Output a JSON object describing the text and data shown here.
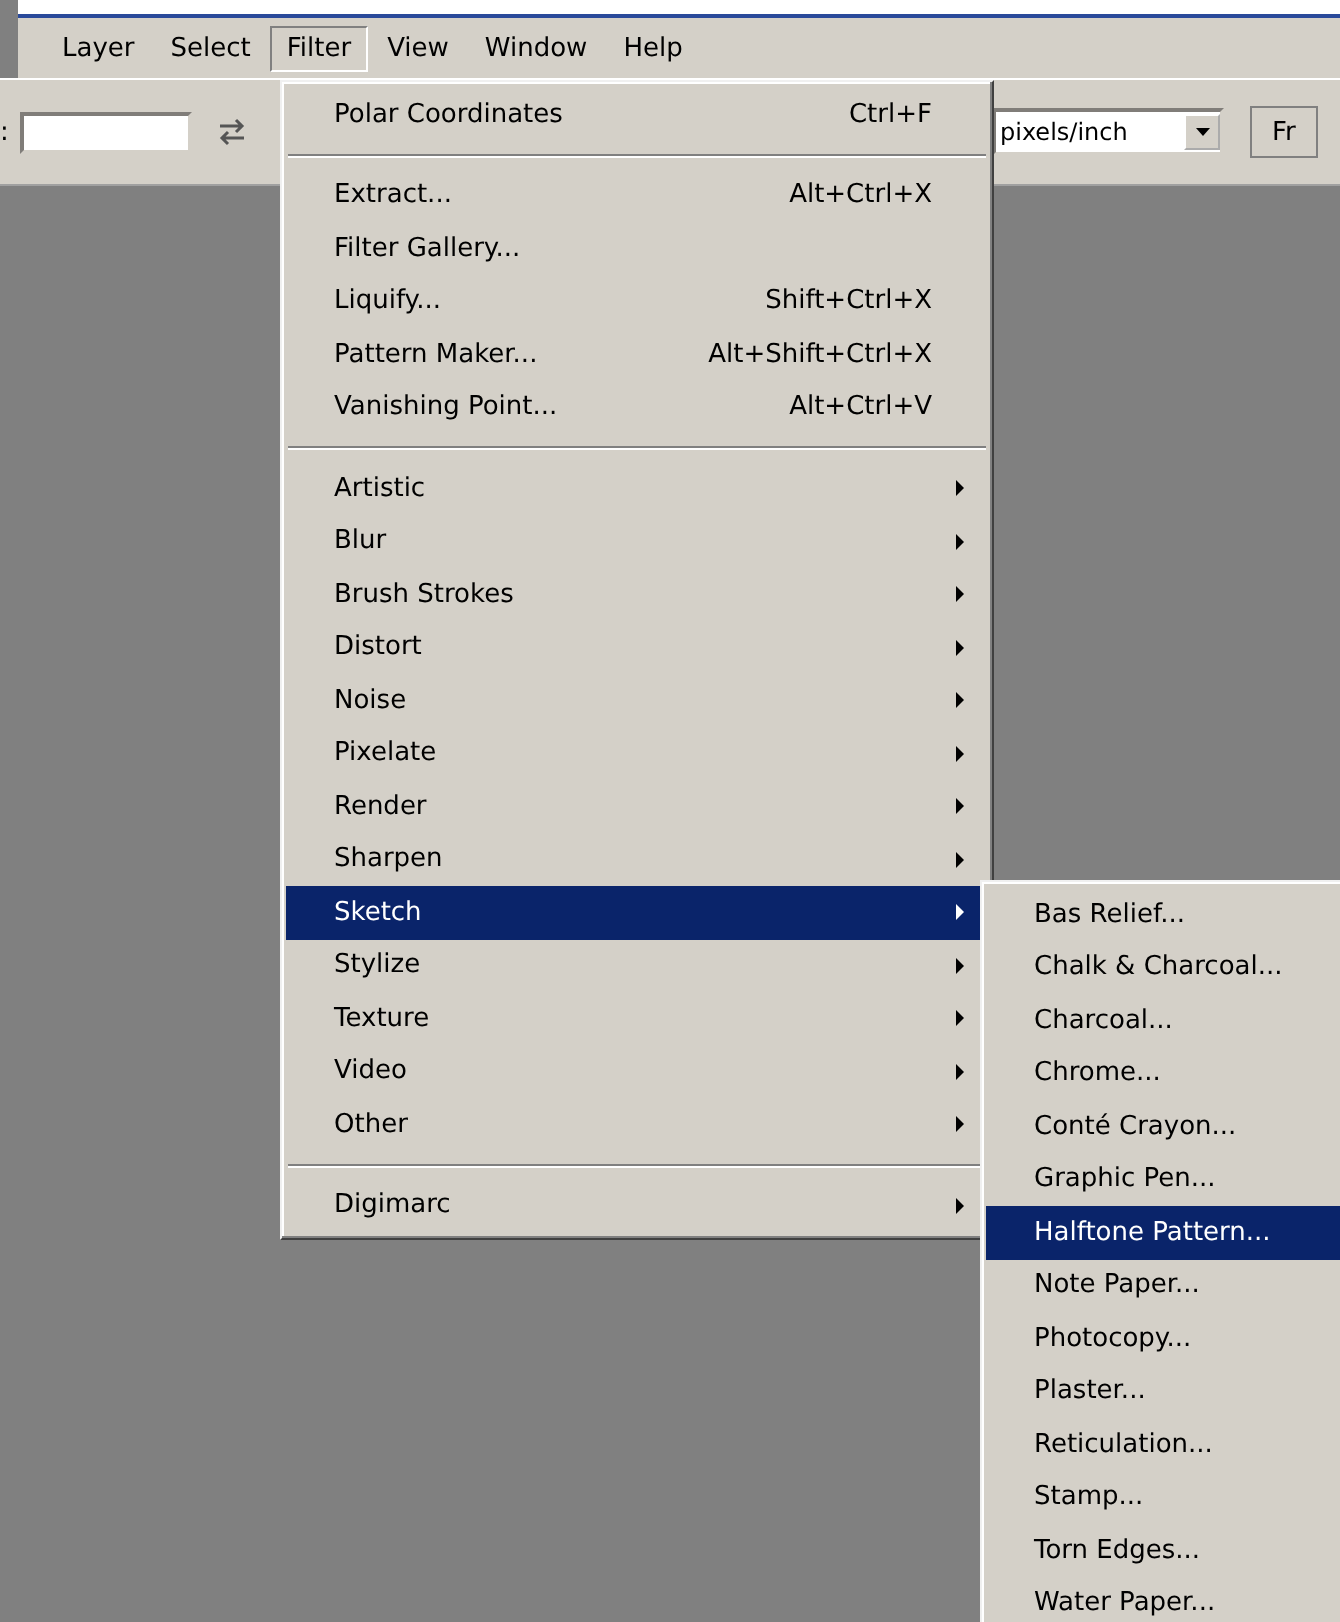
{
  "menubar": [
    {
      "label": "Layer",
      "selected": false
    },
    {
      "label": "Select",
      "selected": false
    },
    {
      "label": "Filter",
      "selected": true
    },
    {
      "label": "View",
      "selected": false
    },
    {
      "label": "Window",
      "selected": false
    },
    {
      "label": "Help",
      "selected": false
    }
  ],
  "options_bar": {
    "label": ":",
    "unit_dropdown": "pixels/inch",
    "button_label": "Fr"
  },
  "filter_menu": {
    "groups": [
      [
        {
          "label": "Polar Coordinates",
          "shortcut": "Ctrl+F",
          "submenu": false,
          "selected": false
        }
      ],
      [
        {
          "label": "Extract...",
          "shortcut": "Alt+Ctrl+X",
          "submenu": false,
          "selected": false
        },
        {
          "label": "Filter Gallery...",
          "submenu": false,
          "selected": false
        },
        {
          "label": "Liquify...",
          "shortcut": "Shift+Ctrl+X",
          "submenu": false,
          "selected": false
        },
        {
          "label": "Pattern Maker...",
          "shortcut": "Alt+Shift+Ctrl+X",
          "submenu": false,
          "selected": false
        },
        {
          "label": "Vanishing Point...",
          "shortcut": "Alt+Ctrl+V",
          "submenu": false,
          "selected": false
        }
      ],
      [
        {
          "label": "Artistic",
          "submenu": true,
          "selected": false
        },
        {
          "label": "Blur",
          "submenu": true,
          "selected": false
        },
        {
          "label": "Brush Strokes",
          "submenu": true,
          "selected": false
        },
        {
          "label": "Distort",
          "submenu": true,
          "selected": false
        },
        {
          "label": "Noise",
          "submenu": true,
          "selected": false
        },
        {
          "label": "Pixelate",
          "submenu": true,
          "selected": false
        },
        {
          "label": "Render",
          "submenu": true,
          "selected": false
        },
        {
          "label": "Sharpen",
          "submenu": true,
          "selected": false
        },
        {
          "label": "Sketch",
          "submenu": true,
          "selected": true
        },
        {
          "label": "Stylize",
          "submenu": true,
          "selected": false
        },
        {
          "label": "Texture",
          "submenu": true,
          "selected": false
        },
        {
          "label": "Video",
          "submenu": true,
          "selected": false
        },
        {
          "label": "Other",
          "submenu": true,
          "selected": false
        }
      ],
      [
        {
          "label": "Digimarc",
          "submenu": true,
          "selected": false
        }
      ]
    ]
  },
  "sketch_submenu": {
    "items": [
      {
        "label": "Bas Relief...",
        "selected": false
      },
      {
        "label": "Chalk & Charcoal...",
        "selected": false
      },
      {
        "label": "Charcoal...",
        "selected": false
      },
      {
        "label": "Chrome...",
        "selected": false
      },
      {
        "label": "Conté Crayon...",
        "selected": false
      },
      {
        "label": "Graphic Pen...",
        "selected": false
      },
      {
        "label": "Halftone Pattern...",
        "selected": true
      },
      {
        "label": "Note Paper...",
        "selected": false
      },
      {
        "label": "Photocopy...",
        "selected": false
      },
      {
        "label": "Plaster...",
        "selected": false
      },
      {
        "label": "Reticulation...",
        "selected": false
      },
      {
        "label": "Stamp...",
        "selected": false
      },
      {
        "label": "Torn Edges...",
        "selected": false
      },
      {
        "label": "Water Paper...",
        "selected": false
      }
    ]
  }
}
